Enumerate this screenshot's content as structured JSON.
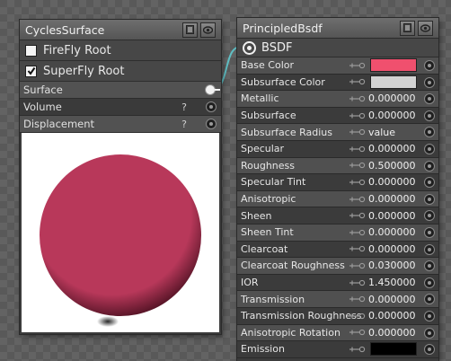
{
  "left_node": {
    "title": "CyclesSurface",
    "checkboxes": [
      {
        "label": "FireFly Root",
        "checked": false
      },
      {
        "label": "SuperFly Root",
        "checked": true
      }
    ],
    "sockets": [
      {
        "label": "Surface",
        "help": ""
      },
      {
        "label": "Volume",
        "help": "?"
      },
      {
        "label": "Displacement",
        "help": "?"
      }
    ],
    "preview_color": "#b8385a"
  },
  "right_node": {
    "title": "PrincipledBsdf",
    "input_label": "BSDF",
    "properties": [
      {
        "label": "Base Color",
        "type": "color",
        "color": "#f0506e"
      },
      {
        "label": "Subsurface Color",
        "type": "color",
        "color": "#d2d2d2"
      },
      {
        "label": "Metallic",
        "type": "value",
        "value": "0.000000"
      },
      {
        "label": "Subsurface",
        "type": "value",
        "value": "0.000000"
      },
      {
        "label": "Subsurface Radius",
        "type": "value",
        "value": "value"
      },
      {
        "label": "Specular",
        "type": "value",
        "value": "0.000000"
      },
      {
        "label": "Roughness",
        "type": "value",
        "value": "0.500000"
      },
      {
        "label": "Specular Tint",
        "type": "value",
        "value": "0.000000"
      },
      {
        "label": "Anisotropic",
        "type": "value",
        "value": "0.000000"
      },
      {
        "label": "Sheen",
        "type": "value",
        "value": "0.000000"
      },
      {
        "label": "Sheen Tint",
        "type": "value",
        "value": "0.000000"
      },
      {
        "label": "Clearcoat",
        "type": "value",
        "value": "0.000000"
      },
      {
        "label": "Clearcoat Roughness",
        "type": "value",
        "value": "0.030000"
      },
      {
        "label": "IOR",
        "type": "value",
        "value": "1.450000"
      },
      {
        "label": "Transmission",
        "type": "value",
        "value": "0.000000"
      },
      {
        "label": "Transmission Roughness",
        "type": "value",
        "value": "0.000000"
      },
      {
        "label": "Anisotropic Rotation",
        "type": "value",
        "value": "0.000000"
      },
      {
        "label": "Emission",
        "type": "color",
        "color": "#000000"
      }
    ]
  },
  "connection_color": "#5fbfc4"
}
